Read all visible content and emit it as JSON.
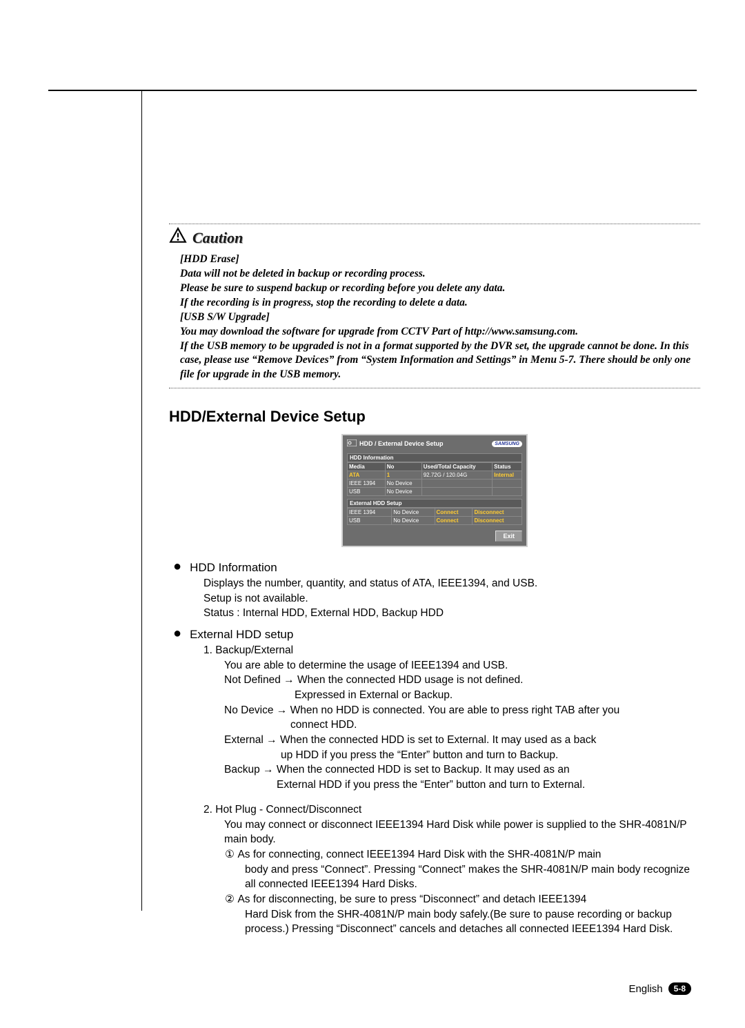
{
  "caution": {
    "title": "Caution",
    "lines": [
      "[HDD Erase]",
      "Data will not be deleted in backup or recording process.",
      "Please be sure to suspend backup or recording before you delete any data.",
      "If the recording is in progress, stop the recording to delete a data.",
      "[USB S/W Upgrade]",
      "You may download the software for upgrade from CCTV Part of http://www.samsung.com.",
      "If the USB memory to be upgraded is not in a format supported by the DVR set, the upgrade cannot be done. In this case, please use “Remove Devices” from “System Information and Settings” in Menu 5-7. There should be only one file for upgrade in the USB memory."
    ]
  },
  "section_title": "HDD/External Device Setup",
  "dvr": {
    "title": "HDD / External Device Setup",
    "brand": "SAMSUNG",
    "info_header": "HDD Information",
    "info_cols": [
      "Media",
      "No",
      "Used/Total Capacity",
      "Status"
    ],
    "info_rows": [
      {
        "media": "ATA",
        "no": "1",
        "cap": "92.72G / 120.04G",
        "status": "Internal",
        "accent": true
      },
      {
        "media": "IEEE 1394",
        "no": "No Device",
        "cap": "",
        "status": "",
        "accent": false
      },
      {
        "media": "USB",
        "no": "No Device",
        "cap": "",
        "status": "",
        "accent": false
      }
    ],
    "ext_header": "External HDD Setup",
    "ext_rows": [
      {
        "media": "IEEE 1394",
        "no": "No Device",
        "c": "Connect",
        "d": "Disconnect"
      },
      {
        "media": "USB",
        "no": "No Device",
        "c": "Connect",
        "d": "Disconnect"
      }
    ],
    "exit": "Exit"
  },
  "hdd_info": {
    "title": "HDD Information",
    "l1": "Displays the number, quantity, and status of ATA, IEEE1394, and USB.",
    "l2": "Setup is not available.",
    "l3": "Status : Internal HDD, External HDD, Backup HDD"
  },
  "ext_setup": {
    "title": "External HDD setup",
    "item1": {
      "num": "1.",
      "title": "Backup/External",
      "l1": "You are able to determine the usage of IEEE1394 and USB.",
      "nd_label": "Not Defined",
      "nd_a": "When the connected HDD usage is not defined.",
      "nd_b": "Expressed in External or Backup.",
      "nodev_label": "No Device",
      "nodev_a": "When no HDD is connected. You are able to press right TAB after you",
      "nodev_b": "connect HDD.",
      "ext_label": "External",
      "ext_a": "When the connected HDD is set to External. It may used as a back",
      "ext_b": "up HDD if you press the “Enter” button and turn to Backup.",
      "bk_label": "Backup",
      "bk_a": "When the connected HDD is set to Backup. It may used as an",
      "bk_b": "External HDD if you press the “Enter” button and turn to External."
    },
    "item2": {
      "num": "2.",
      "title": "Hot Plug - Connect/Disconnect",
      "l1": "You may connect or disconnect IEEE1394 Hard Disk while power is supplied to the SHR-4081N/P main body.",
      "c1a": "As for connecting, connect IEEE1394 Hard Disk with the SHR-4081N/P main",
      "c1b": "body and press “Connect”. Pressing “Connect” makes the SHR-4081N/P main body recognize all connected IEEE1394 Hard Disks.",
      "c2a": "As for disconnecting, be sure to press “Disconnect” and detach IEEE1394",
      "c2b": "Hard Disk from the SHR-4081N/P main body safely.(Be sure to pause recording or backup process.) Pressing “Disconnect” cancels and detaches all connected IEEE1394 Hard Disk."
    }
  },
  "footer": {
    "lang": "English",
    "page": "5-8"
  }
}
